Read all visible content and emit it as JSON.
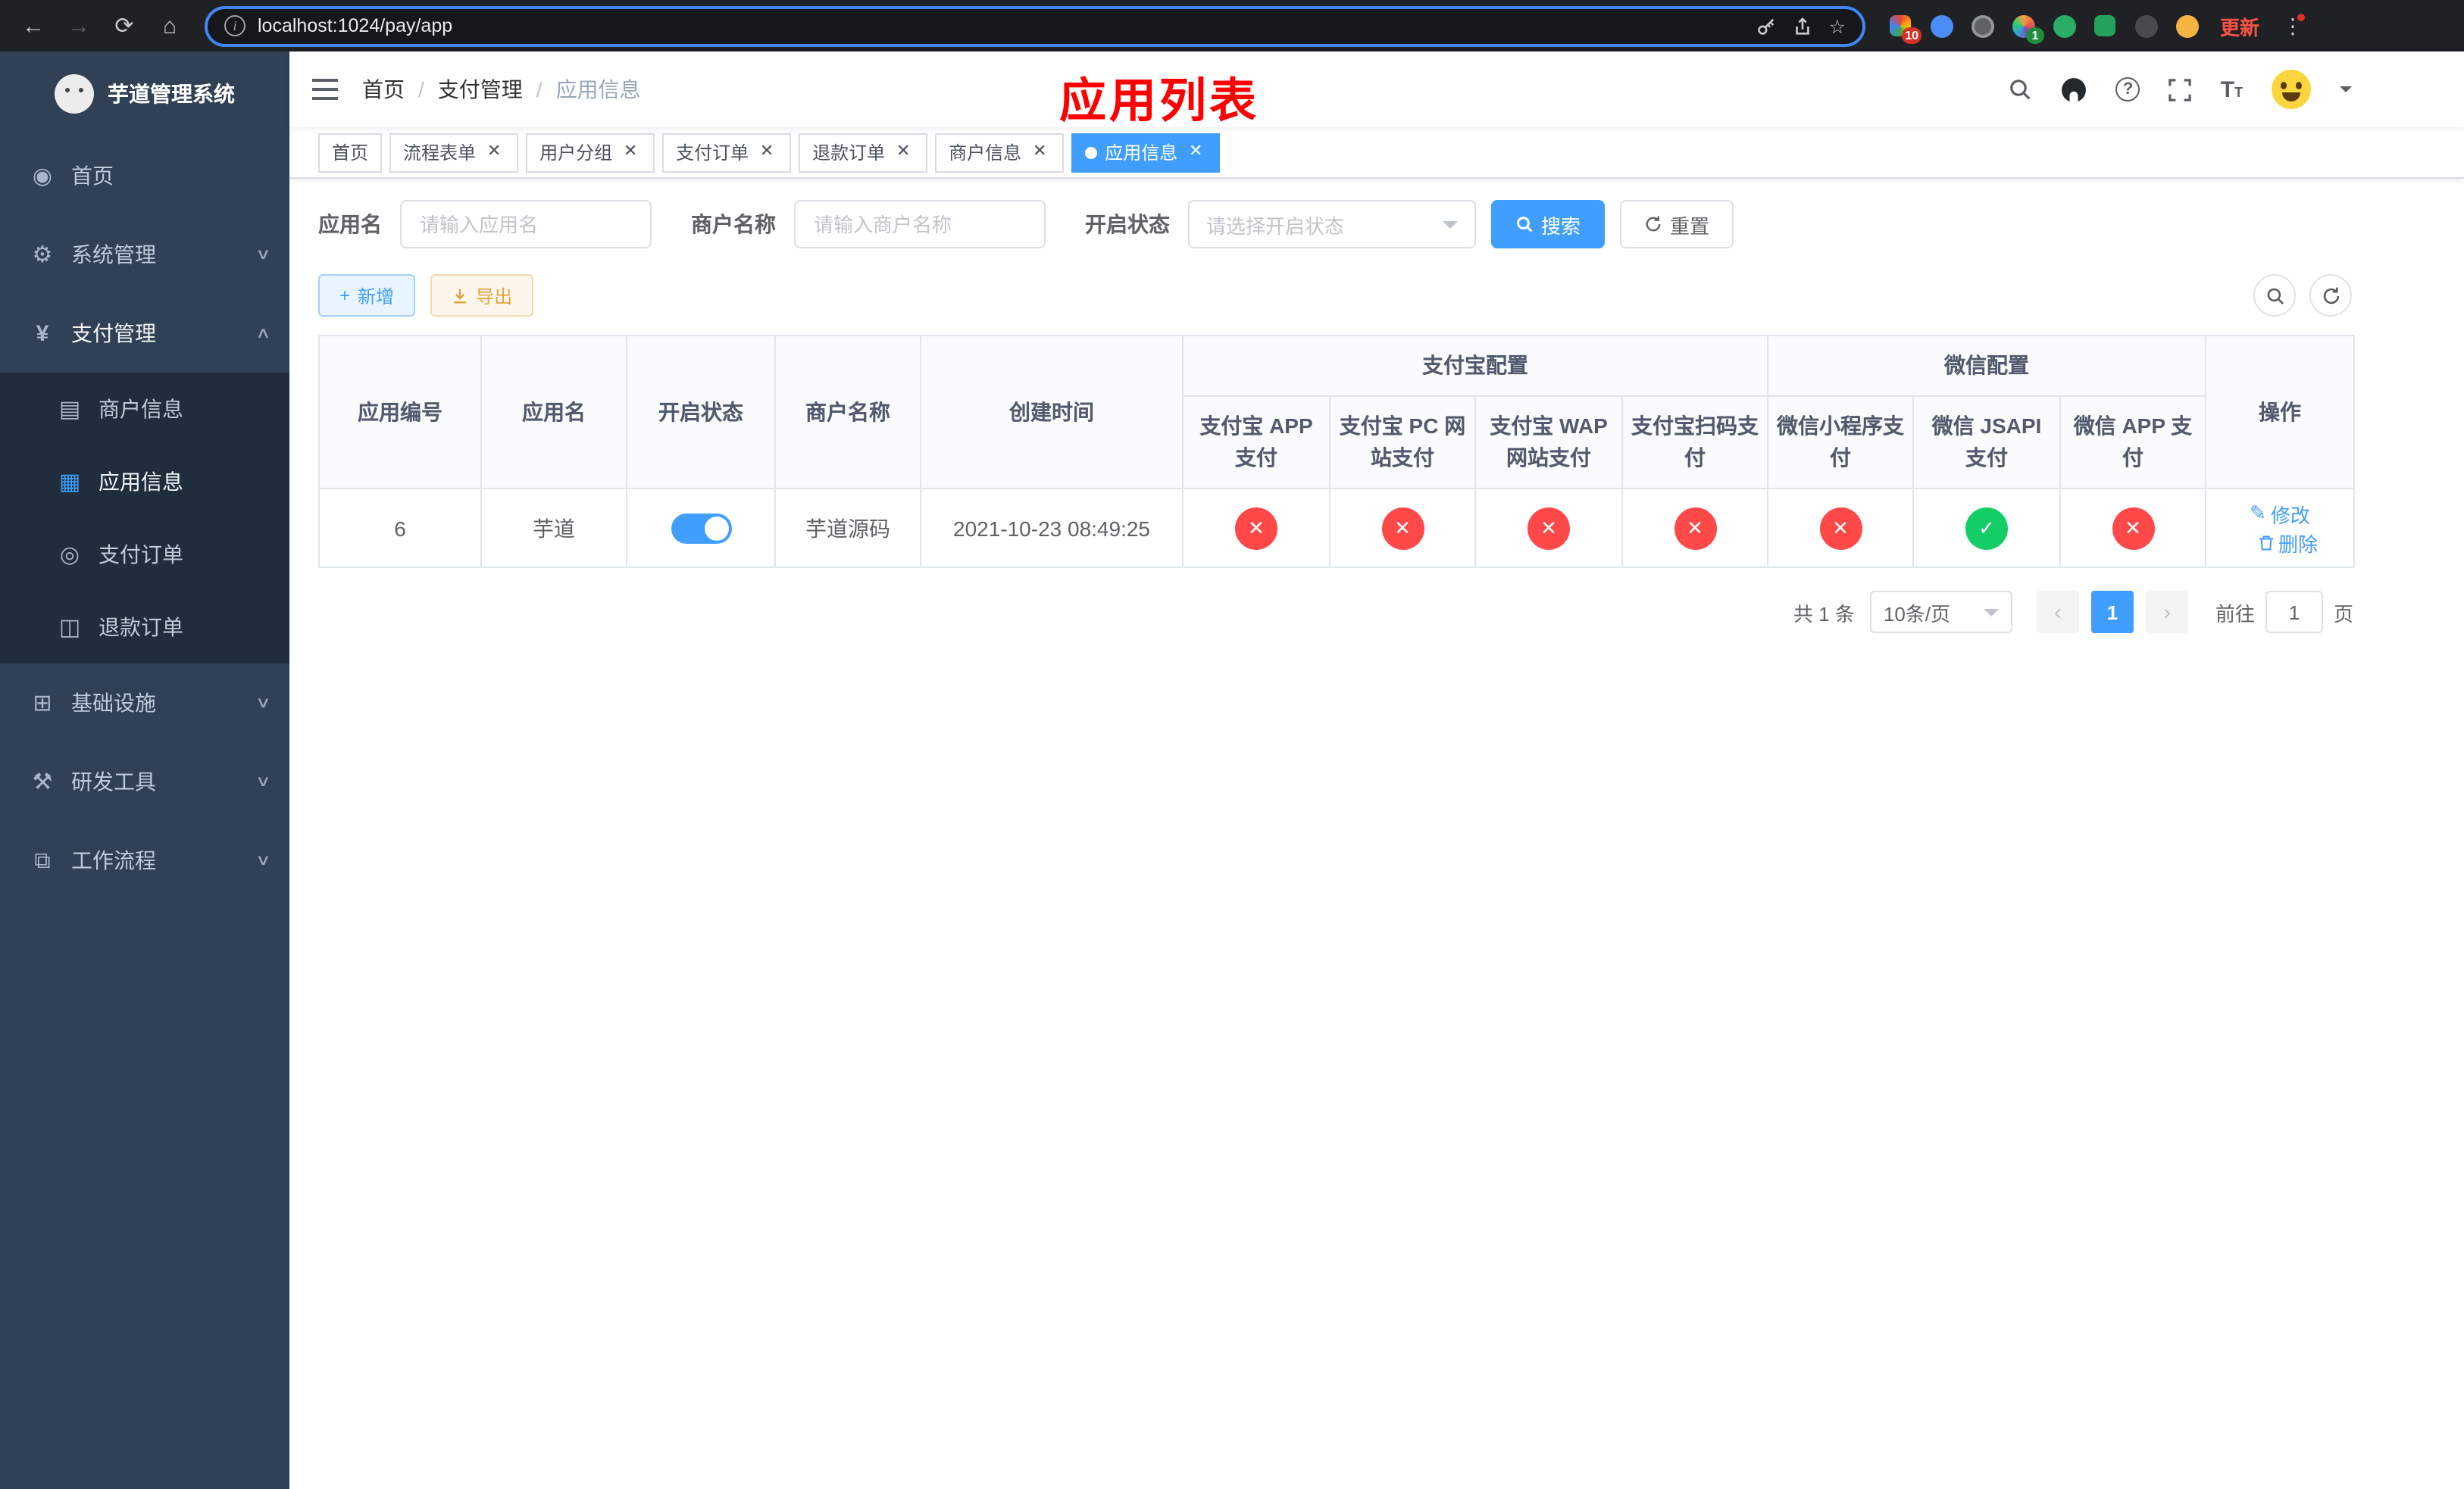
{
  "browser": {
    "url": "localhost:1024/pay/app",
    "update_label": "更新",
    "ext_badge_red": "10",
    "ext_badge_green": "1"
  },
  "sidebar": {
    "title": "芋道管理系统",
    "menu": [
      {
        "label": "首页"
      },
      {
        "label": "系统管理"
      },
      {
        "label": "支付管理"
      },
      {
        "label": "基础设施"
      },
      {
        "label": "研发工具"
      },
      {
        "label": "工作流程"
      }
    ],
    "submenu": [
      {
        "label": "商户信息"
      },
      {
        "label": "应用信息"
      },
      {
        "label": "支付订单"
      },
      {
        "label": "退款订单"
      }
    ]
  },
  "header": {
    "breadcrumb": [
      "首页",
      "支付管理",
      "应用信息"
    ],
    "annotation": "应用列表"
  },
  "tabs": [
    {
      "label": "首页"
    },
    {
      "label": "流程表单"
    },
    {
      "label": "用户分组"
    },
    {
      "label": "支付订单"
    },
    {
      "label": "退款订单"
    },
    {
      "label": "商户信息"
    },
    {
      "label": "应用信息"
    }
  ],
  "filters": {
    "app_name_label": "应用名",
    "app_name_placeholder": "请输入应用名",
    "merchant_label": "商户名称",
    "merchant_placeholder": "请输入商户名称",
    "status_label": "开启状态",
    "status_placeholder": "请选择开启状态",
    "search_label": "搜索",
    "reset_label": "重置"
  },
  "toolbar": {
    "add_label": "新增",
    "export_label": "导出"
  },
  "table": {
    "headers": {
      "id": "应用编号",
      "name": "应用名",
      "status": "开启状态",
      "merchant": "商户名称",
      "created": "创建时间",
      "alipay_group": "支付宝配置",
      "wechat_group": "微信配置",
      "alipay_app": "支付宝 APP 支付",
      "alipay_pc": "支付宝 PC 网站支付",
      "alipay_wap": "支付宝 WAP 网站支付",
      "alipay_qr": "支付宝扫码支付",
      "wechat_lite": "微信小程序支付",
      "wechat_jsapi": "微信 JSAPI 支付",
      "wechat_app": "微信 APP 支付",
      "actions": "操作"
    },
    "row": {
      "id": "6",
      "name": "芋道",
      "enabled": true,
      "merchant": "芋道源码",
      "created": "2021-10-23 08:49:25",
      "statuses": [
        "x",
        "x",
        "x",
        "x",
        "x",
        "check",
        "x"
      ],
      "edit_label": "修改",
      "delete_label": "删除"
    }
  },
  "pagination": {
    "total": "共 1 条",
    "page_size": "10条/页",
    "page": "1",
    "goto_label": "前往",
    "goto_value": "1",
    "goto_suffix": "页"
  },
  "colors": {
    "primary": "#409eff",
    "success": "#13ce66",
    "danger": "#ff4949",
    "sidebar_bg": "#304156",
    "submenu_bg": "#1f2d3d"
  }
}
